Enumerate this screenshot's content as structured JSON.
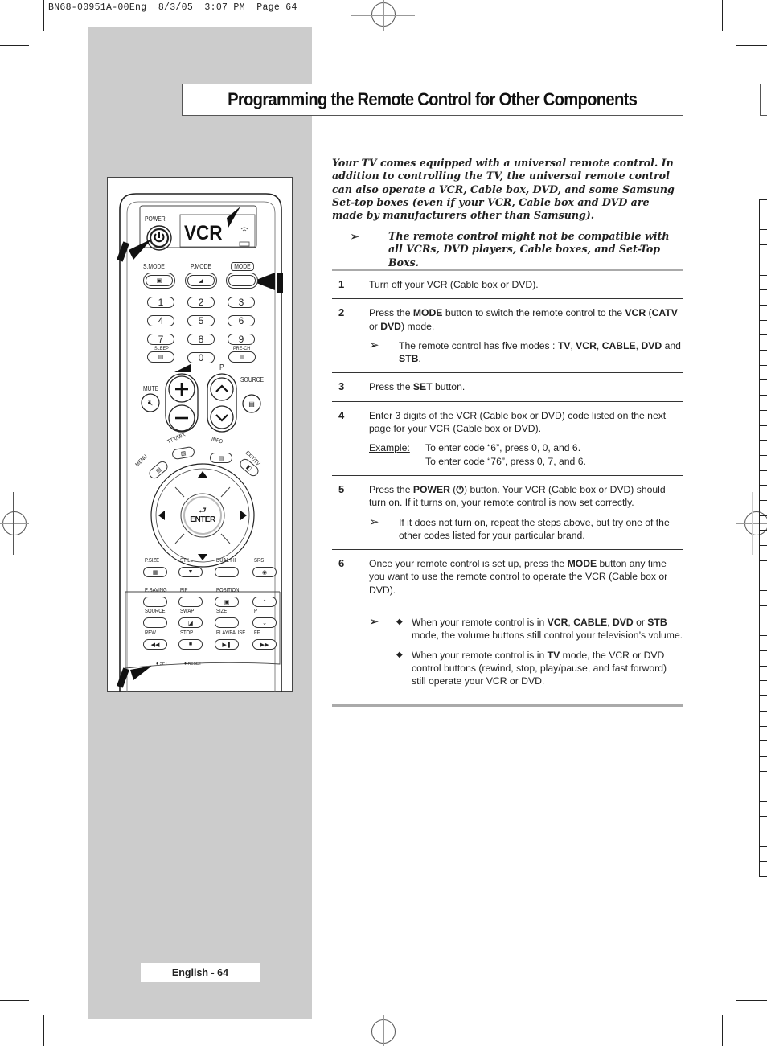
{
  "print_slug": "BN68-00951A-00Eng  8/3/05  3:07 PM  Page 64",
  "page_title": "Programming the Remote Control for Other Components",
  "intro": {
    "paragraph": "Your TV comes equipped with a universal remote control. In addition to controlling the TV, the universal remote control can also operate a VCR, Cable box, DVD, and some Samsung Set-top boxes (even if your VCR, Cable box and DVD are made by manufacturers other than Samsung).",
    "note_icon": "arrow-note-icon",
    "note": "The remote control might not be compatible with all VCRs, DVD players, Cable boxes, and Set-Top Boxs."
  },
  "steps": [
    {
      "num": "1",
      "text": "Turn off your VCR (Cable box or DVD)."
    },
    {
      "num": "2",
      "parts": [
        "Press the ",
        "MODE",
        " button to switch the remote control to the ",
        "VCR",
        " (",
        "CATV",
        " or ",
        "DVD",
        ") mode."
      ],
      "note_parts": [
        "The remote control has five modes : ",
        "TV",
        ", ",
        "VCR",
        ", ",
        "CABLE",
        ", ",
        "DVD",
        " and ",
        "STB",
        "."
      ]
    },
    {
      "num": "3",
      "parts": [
        "Press the ",
        "SET",
        " button."
      ]
    },
    {
      "num": "4",
      "text": "Enter 3 digits of the VCR (Cable box or DVD) code listed on the next page for your VCR (Cable box or DVD).",
      "example_label": "Example",
      "example_lines": [
        "To enter code “6”, press 0, 0, and 6.",
        "To enter code “76”, press 0, 7, and 6."
      ]
    },
    {
      "num": "5",
      "parts": [
        "Press the ",
        "POWER",
        " (",
        "⏻",
        ") button. Your VCR (Cable box or DVD) should turn on. If it turns on, your remote control is now set correctly."
      ],
      "note": "If it does not turn on, repeat the steps above, but try one of the other codes listed for your particular brand."
    },
    {
      "num": "6",
      "parts": [
        "Once your remote control is set up, press the ",
        "MODE",
        " button any time you want to use the remote control to operate the VCR (Cable box or DVD)."
      ],
      "bullets": [
        [
          "When your remote control is in ",
          "VCR",
          ", ",
          "CABLE",
          ", ",
          "DVD",
          " or ",
          "STB",
          " mode, the volume buttons still control your television’s volume."
        ],
        [
          "When your remote control is in ",
          "TV",
          " mode, the VCR or DVD control buttons (rewind, stop, play/pause, and fast forword) still operate your VCR or DVD."
        ]
      ]
    }
  ],
  "footer": "English - 64",
  "remote": {
    "display": "VCR",
    "labels": {
      "power": "POWER",
      "smode": "S.MODE",
      "pmode": "P.MODE",
      "mode": "MODE",
      "sleep": "SLEEP",
      "prech": "PRE-CH",
      "p": "P",
      "mute": "MUTE",
      "source": "SOURCE",
      "ttx": "TTX/MIX",
      "info": "INFO",
      "menu": "MENU",
      "exit": "EXIT/TV",
      "enter": "ENTER",
      "psize": "P.SIZE",
      "still": "STILL",
      "dual": "DUAL I-II",
      "srs": "SRS",
      "esaving": "E.SAVING",
      "pip": "PIP",
      "position": "POSITION",
      "source2": "SOURCE",
      "swap": "SWAP",
      "size": "SIZE",
      "p2": "P",
      "rew": "REW",
      "stop": "STOP",
      "playpause": "PLAY/PAUSE",
      "ff": "FF",
      "set": "SET",
      "reset": "RESET"
    },
    "digits": [
      "1",
      "2",
      "3",
      "4",
      "5",
      "6",
      "7",
      "8",
      "9",
      "0"
    ]
  }
}
